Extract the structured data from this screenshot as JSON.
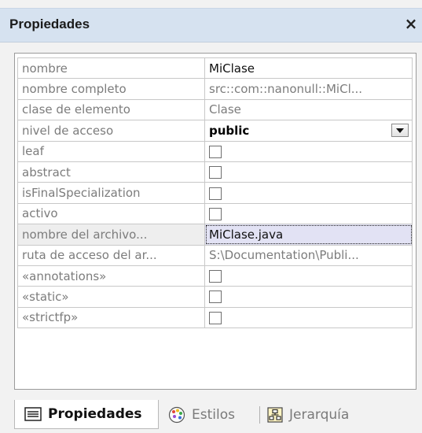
{
  "window": {
    "title": "Propiedades",
    "close_glyph": "×"
  },
  "properties": [
    {
      "name": "nombre",
      "value": "MiClase",
      "kind": "text",
      "style": "normal"
    },
    {
      "name": "nombre completo",
      "value": "src::com::nanonull::MiCl...",
      "kind": "text",
      "style": "muted"
    },
    {
      "name": "clase de elemento",
      "value": "Clase",
      "kind": "text",
      "style": "muted"
    },
    {
      "name": "nivel de acceso",
      "value": "public",
      "kind": "dropdown",
      "style": "strong"
    },
    {
      "name": "leaf",
      "checked": false,
      "kind": "checkbox"
    },
    {
      "name": "abstract",
      "checked": false,
      "kind": "checkbox"
    },
    {
      "name": "isFinalSpecialization",
      "checked": false,
      "kind": "checkbox"
    },
    {
      "name": "activo",
      "checked": false,
      "kind": "checkbox"
    },
    {
      "name": "nombre del archivo...",
      "value": "MiClase.java",
      "kind": "text",
      "style": "normal",
      "selected": true
    },
    {
      "name": "ruta de acceso del ar...",
      "value": "S:\\Documentation\\Publi...",
      "kind": "text",
      "style": "muted"
    },
    {
      "name": "«annotations»",
      "checked": false,
      "kind": "checkbox"
    },
    {
      "name": "«static»",
      "checked": false,
      "kind": "checkbox"
    },
    {
      "name": "«strictfp»",
      "checked": false,
      "kind": "checkbox"
    }
  ],
  "tabs": [
    {
      "label": "Propiedades",
      "icon": "properties-list-icon",
      "active": true
    },
    {
      "label": "Estilos",
      "icon": "palette-icon",
      "active": false
    },
    {
      "label": "Jerarquía",
      "icon": "hierarchy-icon",
      "active": false
    }
  ],
  "colors": {
    "title_bar": "#d6e2f0",
    "selected_value": "#e2e2f4",
    "label_gray": "#7c7c7c"
  }
}
